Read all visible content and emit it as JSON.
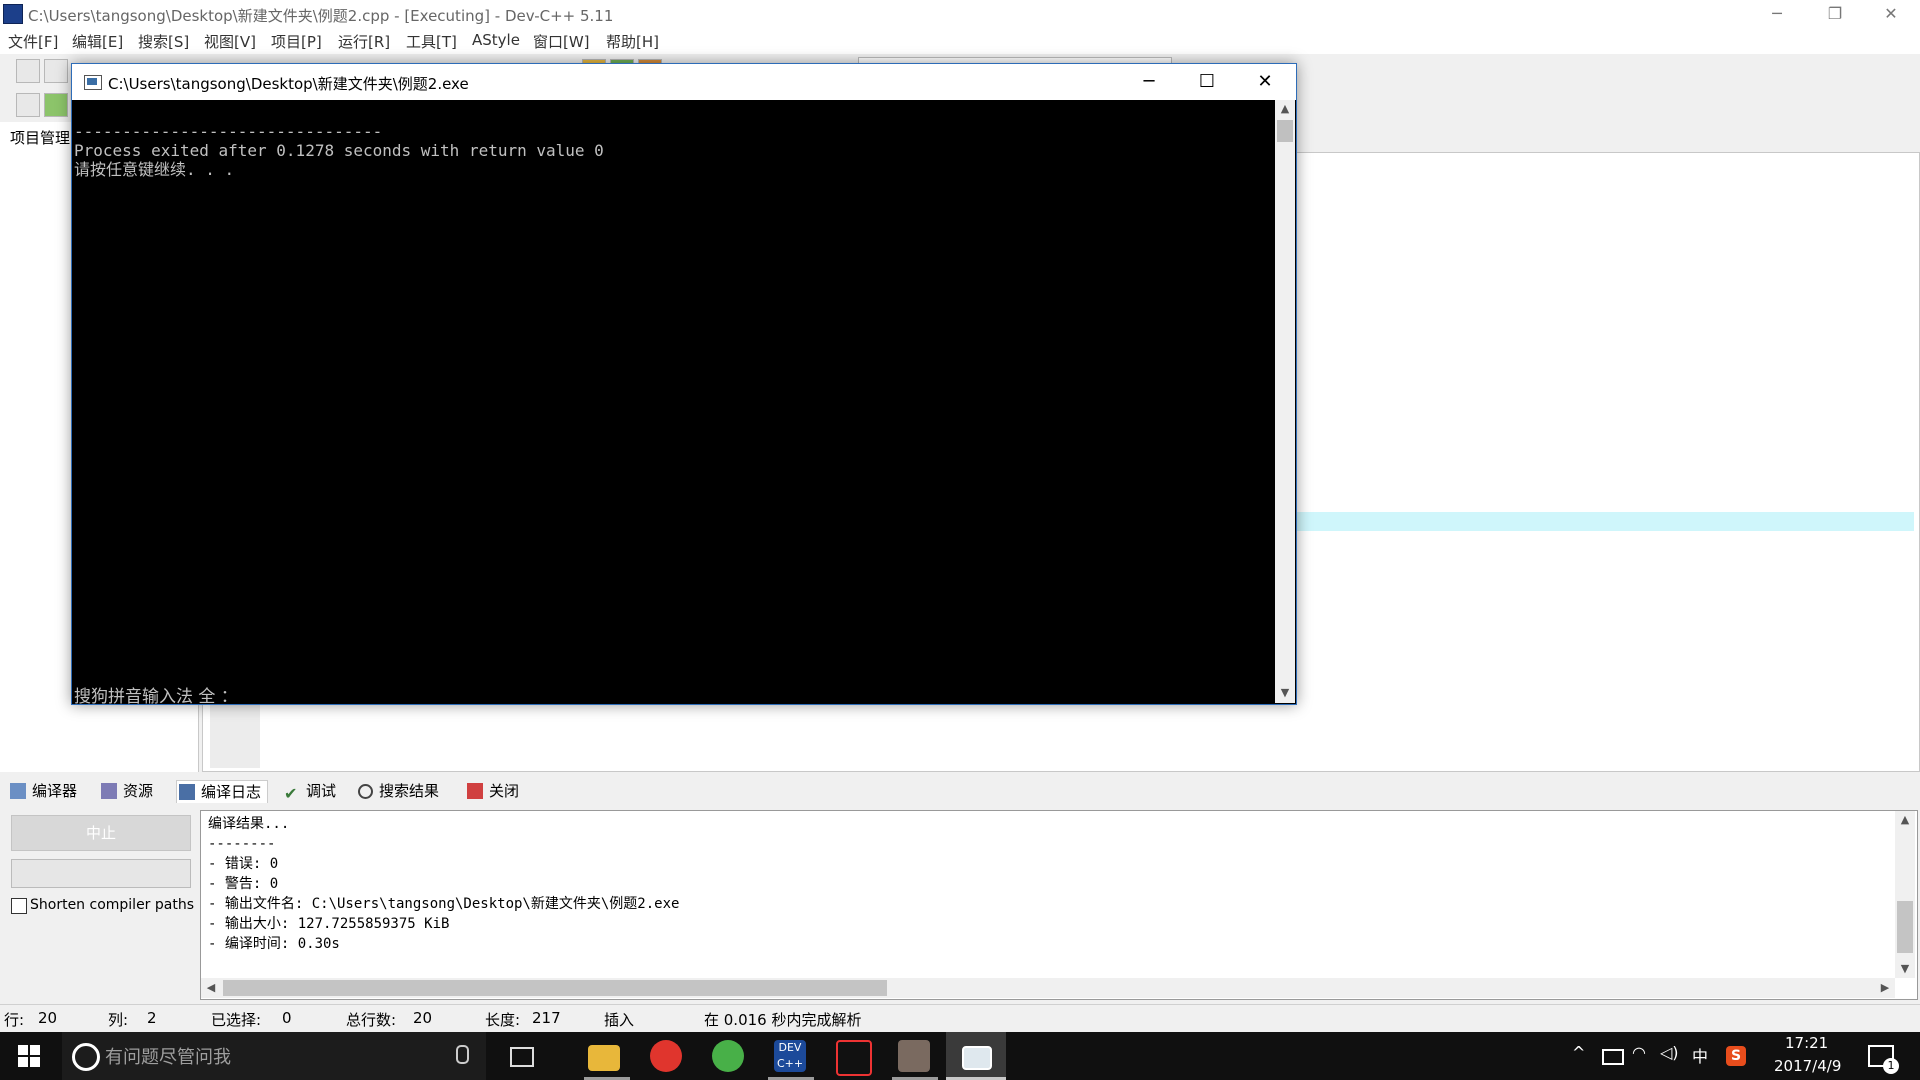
{
  "ide": {
    "title": "C:\\Users\\tangsong\\Desktop\\新建文件夹\\例题2.cpp - [Executing] - Dev-C++ 5.11",
    "window_controls": {
      "minimize": "─",
      "restore": "❐",
      "close": "✕"
    },
    "menu": [
      "文件[F]",
      "编辑[E]",
      "搜索[S]",
      "视图[V]",
      "项目[P]",
      "运行[R]",
      "工具[T]",
      "AStyle",
      "窗口[W]",
      "帮助[H]"
    ],
    "project_panel_label": "项目管理"
  },
  "console": {
    "title": "C:\\Users\\tangsong\\Desktop\\新建文件夹\\例题2.exe",
    "controls": {
      "minimize": "─",
      "maximize": "☐",
      "close": "✕"
    },
    "lines": [
      "--------------------------------",
      "Process exited after 0.1278 seconds with return value 0",
      "请按任意键继续. . ."
    ],
    "ime_status": "搜狗拼音输入法 全 ："
  },
  "bottom_tabs": [
    {
      "label": "编译器",
      "icon": "compiler-icon"
    },
    {
      "label": "资源",
      "icon": "resources-icon"
    },
    {
      "label": "编译日志",
      "icon": "compile-log-icon"
    },
    {
      "label": "调试",
      "icon": "debug-icon"
    },
    {
      "label": "搜索结果",
      "icon": "search-results-icon"
    },
    {
      "label": "关闭",
      "icon": "close-panel-icon"
    }
  ],
  "compile_controls": {
    "stop_label": "中止",
    "shorten_paths_label": "Shorten compiler paths",
    "shorten_paths_checked": false
  },
  "compile_log": [
    "编译结果...",
    "--------",
    "- 错误: 0",
    "- 警告: 0",
    "- 输出文件名: C:\\Users\\tangsong\\Desktop\\新建文件夹\\例题2.exe",
    "- 输出大小: 127.7255859375 KiB",
    "- 编译时间: 0.30s"
  ],
  "statusbar": {
    "row_label": "行:",
    "row_value": "20",
    "col_label": "列:",
    "col_value": "2",
    "selected_label": "已选择:",
    "selected_value": "0",
    "total_label": "总行数:",
    "total_value": "20",
    "length_label": "长度:",
    "length_value": "217",
    "mode": "插入",
    "parse_message": "在 0.016 秒内完成解析"
  },
  "taskbar": {
    "search_placeholder": "有问题尽管问我",
    "apps": [
      "file-explorer-icon",
      "netease-music-icon",
      "browser-icon",
      "devcpp-icon",
      "qq-icon",
      "photo-app-icon",
      "console-app-icon"
    ],
    "tray_ime": "中",
    "clock_time": "17:21",
    "clock_date": "2017/4/9",
    "notification_count": "1"
  }
}
